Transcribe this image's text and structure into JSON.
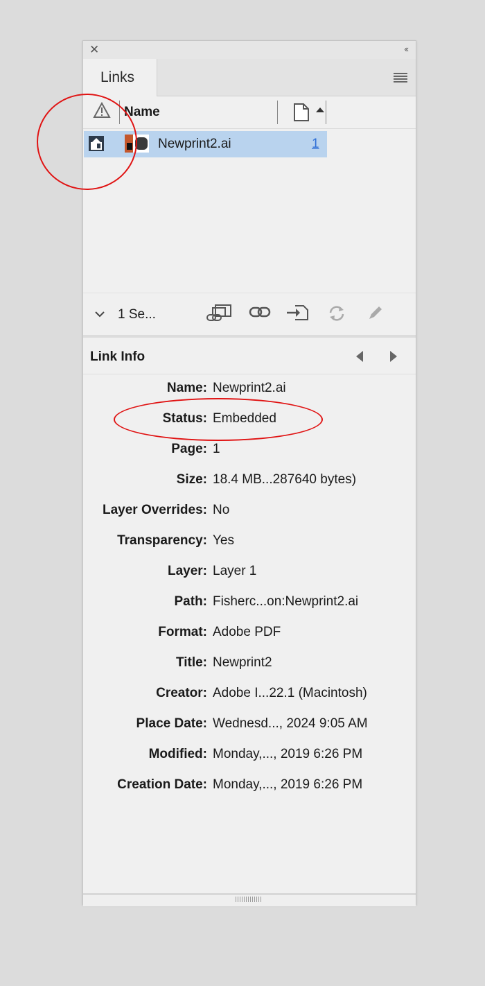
{
  "panel": {
    "tab_label": "Links"
  },
  "columns": {
    "name": "Name"
  },
  "links": [
    {
      "name": "Newprint2.ai",
      "page": "1"
    }
  ],
  "toolbar": {
    "selection_text": "1 Se...",
    "icons": [
      "relink-from-cc-libraries-icon",
      "relink-icon",
      "go-to-link-icon",
      "update-link-icon",
      "edit-original-icon"
    ]
  },
  "link_info": {
    "title": "Link Info",
    "rows": [
      {
        "label": "Name:",
        "value": "Newprint2.ai"
      },
      {
        "label": "Status:",
        "value": "Embedded"
      },
      {
        "label": "Page:",
        "value": "1"
      },
      {
        "label": "Size:",
        "value": "18.4 MB...287640 bytes)"
      },
      {
        "label": "Layer Overrides:",
        "value": "No"
      },
      {
        "label": "Transparency:",
        "value": "Yes"
      },
      {
        "label": "Layer:",
        "value": "Layer 1"
      },
      {
        "label": "Path:",
        "value": "Fisherc...on:Newprint2.ai"
      },
      {
        "label": "Format:",
        "value": "Adobe PDF"
      },
      {
        "label": "Title:",
        "value": "Newprint2"
      },
      {
        "label": "Creator:",
        "value": "Adobe I...22.1 (Macintosh)"
      },
      {
        "label": "Place Date:",
        "value": "Wednesd..., 2024 9:05 AM"
      },
      {
        "label": "Modified:",
        "value": "Monday,..., 2019 6:26 PM"
      },
      {
        "label": "Creation Date:",
        "value": "Monday,..., 2019 6:26 PM"
      }
    ]
  },
  "colors": {
    "selected_row": "#b9d3ee",
    "page_link": "#2f6fd6",
    "annotation": "#e01313"
  }
}
